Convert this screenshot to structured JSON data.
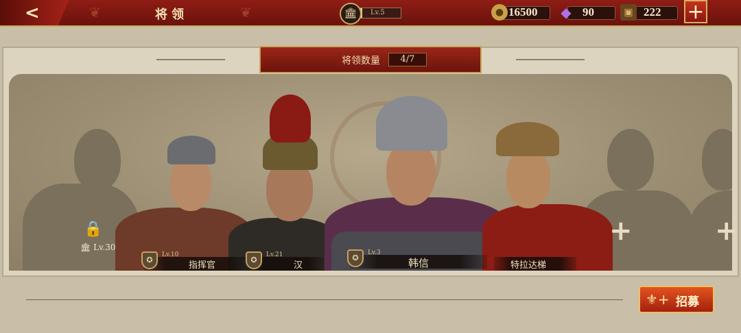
{
  "header": {
    "back_label": "<",
    "title": "将领",
    "level_text": "Lv.5",
    "level_progress": 0.1,
    "plus_label": "+"
  },
  "resources": [
    {
      "name": "gold",
      "value": "16500",
      "icon": "gold-coin-icon"
    },
    {
      "name": "gem",
      "value": "90",
      "icon": "purple-gem-icon"
    },
    {
      "name": "food",
      "value": "222",
      "icon": "supply-icon"
    }
  ],
  "roster": {
    "count_label": "将领数量",
    "count_value": "4/7"
  },
  "slots": {
    "locked": {
      "level": "Lv.30"
    },
    "add_label": "+"
  },
  "heroes": [
    {
      "name": "指挥官",
      "level": "Lv.10"
    },
    {
      "name": "汉",
      "level": "Lv.21"
    },
    {
      "name": "韩信",
      "level": "Lv.3"
    },
    {
      "name": "特拉达梯",
      "level": ""
    }
  ],
  "actions": {
    "recruit_label": "招募"
  },
  "colors": {
    "top_bar": "#7a160e",
    "accent_gold": "#c9a25a",
    "recruit_button": "#d2441a"
  }
}
